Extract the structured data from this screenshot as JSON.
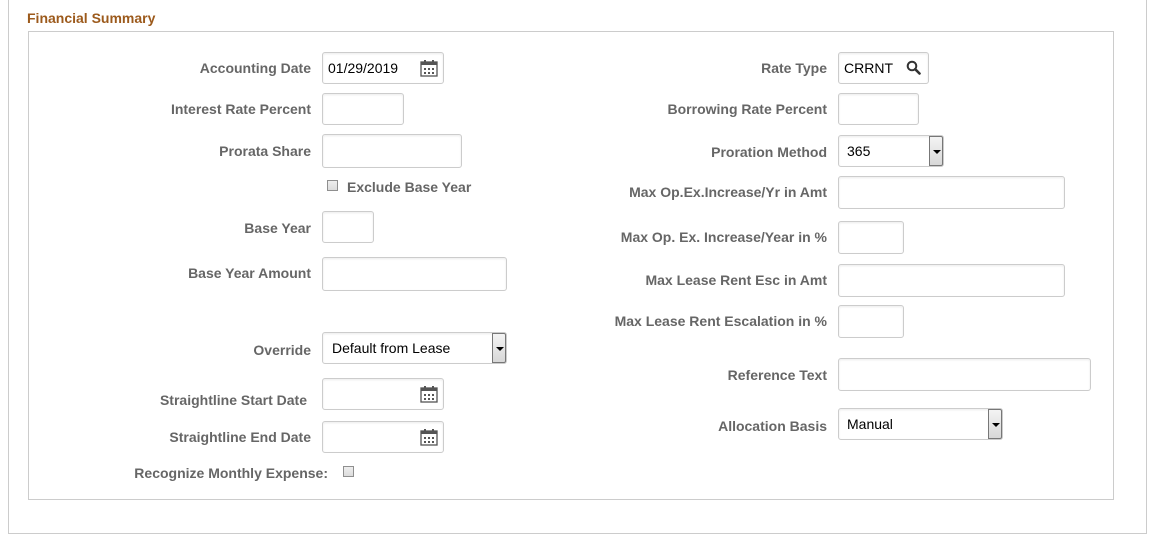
{
  "section": {
    "title": "Financial Summary"
  },
  "left": {
    "accounting_date": {
      "label": "Accounting Date",
      "value": "01/29/2019"
    },
    "interest_rate_percent": {
      "label": "Interest Rate Percent",
      "value": ""
    },
    "prorata_share": {
      "label": "Prorata Share",
      "value": ""
    },
    "exclude_base_year": {
      "label": "Exclude Base Year",
      "checked": false
    },
    "base_year": {
      "label": "Base Year",
      "value": ""
    },
    "base_year_amount": {
      "label": "Base Year Amount",
      "value": ""
    },
    "override": {
      "label": "Override",
      "value": "Default from Lease"
    },
    "straightline_start_date": {
      "label": "Straightline Start Date",
      "value": ""
    },
    "straightline_end_date": {
      "label": "Straightline End Date",
      "value": ""
    },
    "recognize_monthly_expense": {
      "label": "Recognize Monthly Expense:",
      "checked": false
    }
  },
  "right": {
    "rate_type": {
      "label": "Rate Type",
      "value": "CRRNT"
    },
    "borrowing_rate_percent": {
      "label": "Borrowing Rate Percent",
      "value": ""
    },
    "proration_method": {
      "label": "Proration Method",
      "value": "365"
    },
    "max_opex_increase_amt": {
      "label": "Max Op.Ex.Increase/Yr in Amt",
      "value": ""
    },
    "max_opex_increase_pct": {
      "label": "Max Op. Ex. Increase/Year in %",
      "value": ""
    },
    "max_lease_rent_esc_amt": {
      "label": "Max Lease Rent Esc in Amt",
      "value": ""
    },
    "max_lease_rent_esc_pct": {
      "label": "Max Lease Rent Escalation in %",
      "value": ""
    },
    "reference_text": {
      "label": "Reference Text",
      "value": ""
    },
    "allocation_basis": {
      "label": "Allocation Basis",
      "value": "Manual"
    }
  },
  "icons": {
    "calendar": "calendar-icon",
    "lookup": "search-icon",
    "dropdown": "chevron-down-icon"
  },
  "colors": {
    "section_title": "#9c5a1c",
    "label": "#666666",
    "border": "#cccccc"
  }
}
